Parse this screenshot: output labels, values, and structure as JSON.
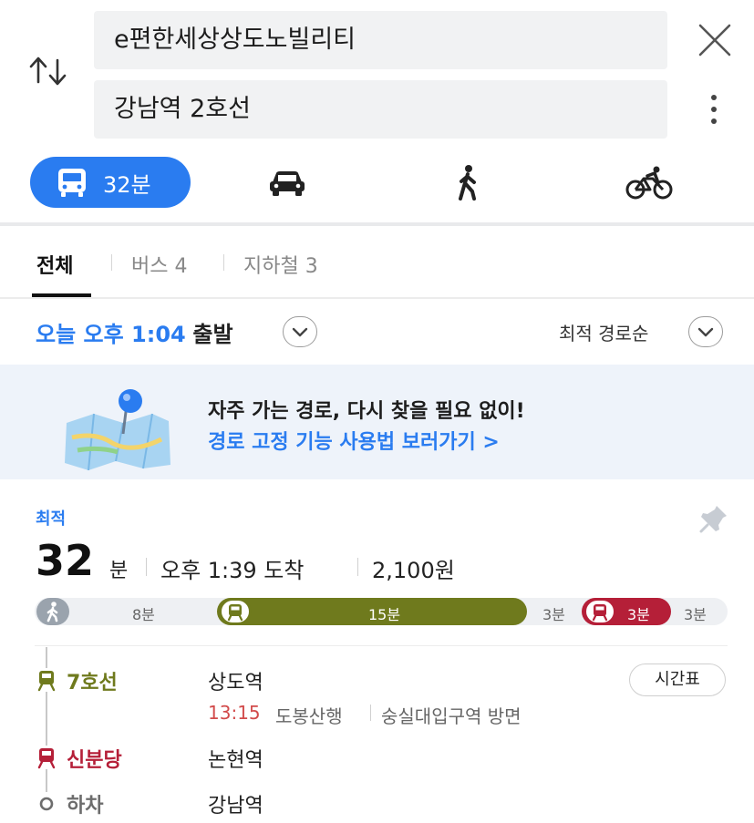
{
  "search": {
    "origin": "e편한세상상도노빌리티",
    "destination": "강남역 2호선"
  },
  "modes": {
    "transit_label": "32분"
  },
  "tabs": [
    {
      "label": "전체"
    },
    {
      "label": "버스 4"
    },
    {
      "label": "지하철 3"
    }
  ],
  "departure": {
    "time": "오늘 오후 1:04",
    "suffix": "출발",
    "sort": "최적 경로순"
  },
  "banner": {
    "title": "자주 가는 경로, 다시 찾을 필요 없이!",
    "link": "경로 고정 기능 사용법 보러가기 >"
  },
  "route": {
    "badge": "최적",
    "duration_num": "32",
    "duration_unit": "분",
    "arrival": "오후 1:39 도착",
    "fare": "2,100원",
    "segments": {
      "walk1": "8분",
      "subway7": "15분",
      "walk2": "3분",
      "bus": "3분",
      "walk3": "3분"
    },
    "legs": [
      {
        "name": "7호선",
        "station": "상도역",
        "color": "#6f7a1d"
      },
      {
        "name": "신분당",
        "station": "논현역",
        "color": "#b51f38"
      },
      {
        "name": "하차",
        "station": "강남역",
        "color": "#6d6d6d"
      }
    ],
    "schedule_label": "시간표",
    "detail": {
      "time": "13:15",
      "direction": "도봉산행",
      "toward": "숭실대입구역 방면"
    }
  },
  "colors": {
    "accent": "#2a7cf0",
    "line7": "#6f7a1d",
    "sinbundang": "#b51f38"
  }
}
